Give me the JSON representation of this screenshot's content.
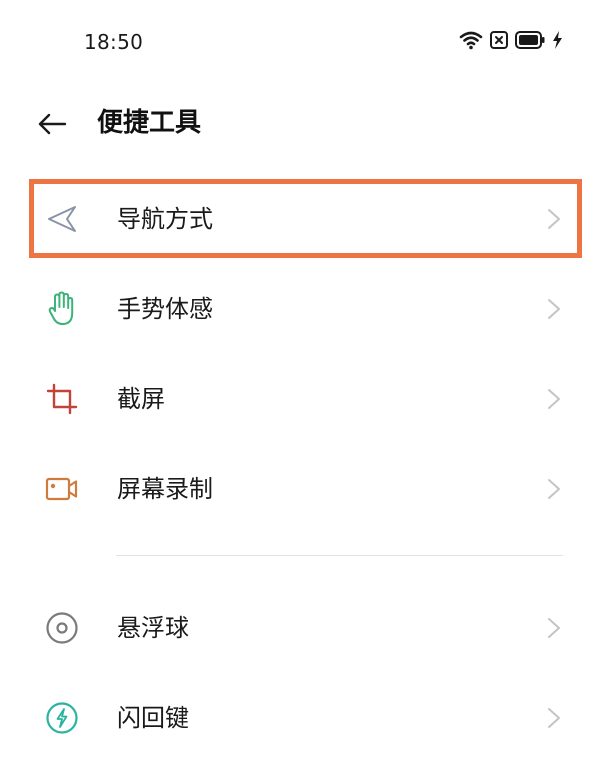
{
  "status_bar": {
    "time": "18:50",
    "icons": [
      "wifi-icon",
      "sim-off-icon",
      "battery-icon",
      "charging-icon"
    ]
  },
  "header": {
    "back_icon": "arrow-left-icon",
    "title": "便捷工具"
  },
  "sections": [
    {
      "items": [
        {
          "label": "导航方式",
          "icon": "navigation-icon",
          "icon_color": "#8a93a6",
          "highlighted": true
        },
        {
          "label": "手势体感",
          "icon": "hand-gesture-icon",
          "icon_color": "#3bb37a"
        },
        {
          "label": "截屏",
          "icon": "crop-icon",
          "icon_color": "#c0443a"
        },
        {
          "label": "屏幕录制",
          "icon": "video-record-icon",
          "icon_color": "#d07a3e"
        }
      ]
    },
    {
      "items": [
        {
          "label": "悬浮球",
          "icon": "floating-ball-icon",
          "icon_color": "#7a7a7a"
        },
        {
          "label": "闪回键",
          "icon": "flashback-key-icon",
          "icon_color": "#2bb3a0"
        }
      ]
    }
  ],
  "colors": {
    "highlight_border": "#ee7443",
    "chevron": "#c4c4c4",
    "divider": "#e3e3e3"
  }
}
